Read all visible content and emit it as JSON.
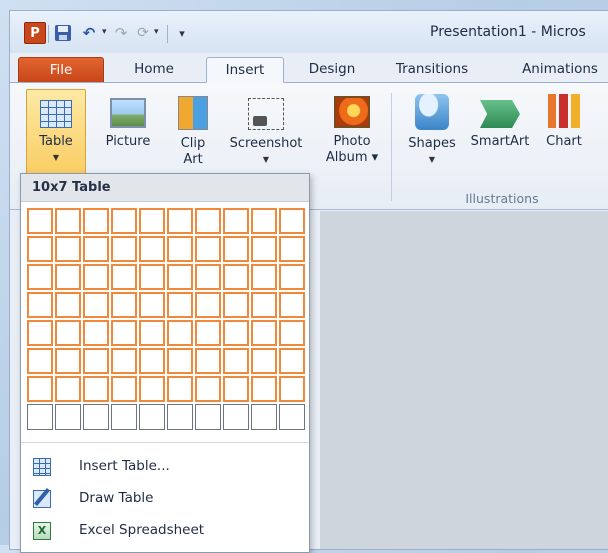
{
  "window": {
    "title": "Presentation1 - Micros"
  },
  "qat": {
    "app_icon": "P",
    "undo": "↶",
    "redo": "↷",
    "repeat": "⟳",
    "customize": "▾"
  },
  "tabs": [
    {
      "label": "File"
    },
    {
      "label": "Home"
    },
    {
      "label": "Insert"
    },
    {
      "label": "Design"
    },
    {
      "label": "Transitions"
    },
    {
      "label": "Animations"
    }
  ],
  "ribbon": {
    "table": {
      "label": "Table"
    },
    "picture": {
      "label": "Picture"
    },
    "clipart": {
      "line1": "Clip",
      "line2": "Art"
    },
    "screenshot": {
      "label": "Screenshot"
    },
    "photoalbum": {
      "line1": "Photo",
      "line2": "Album ▾"
    },
    "shapes": {
      "label": "Shapes"
    },
    "smartart": {
      "label": "SmartArt"
    },
    "chart": {
      "label": "Chart"
    },
    "group_illustrations": "Illustrations"
  },
  "table_dropdown": {
    "header": "10x7 Table",
    "grid": {
      "columns": 10,
      "rows": 8,
      "selected_columns": 10,
      "selected_rows": 7
    },
    "menu": [
      {
        "label": "Insert Table...",
        "icon": "insert-table-icon"
      },
      {
        "label": "Draw Table",
        "icon": "draw-table-icon"
      },
      {
        "label": "Excel Spreadsheet",
        "icon": "excel-spreadsheet-icon"
      }
    ]
  },
  "colors": {
    "file_tab": "#d65526",
    "selection_border": "#ef8a3c",
    "active_button": "#f9c856"
  }
}
